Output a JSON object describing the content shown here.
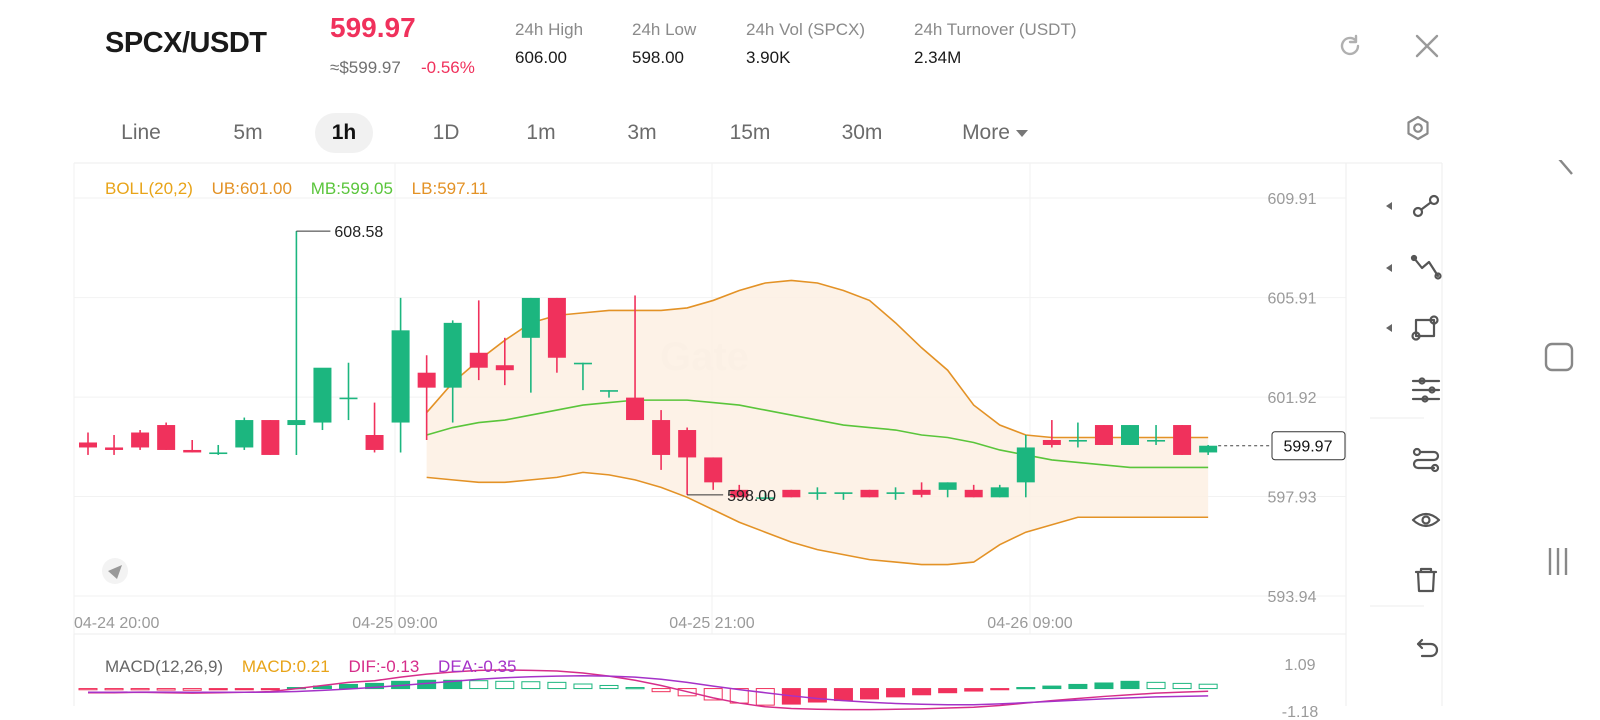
{
  "header": {
    "pair": "SPCX/USDT",
    "last_price": "599.97",
    "usd_price": "≈$599.97",
    "change": "-0.56%",
    "stats": [
      {
        "label": "24h   High",
        "value": "606.00"
      },
      {
        "label": "24h   Low",
        "value": "598.00"
      },
      {
        "label": "24h   Vol (SPCX)",
        "value": "3.90K"
      },
      {
        "label": "24h   Turnover (USDT)",
        "value": "2.34M"
      }
    ]
  },
  "tabs": [
    {
      "label": "Line"
    },
    {
      "label": "5m"
    },
    {
      "label": "1h",
      "active": true
    },
    {
      "label": "1D"
    },
    {
      "label": "1m"
    },
    {
      "label": "3m"
    },
    {
      "label": "15m"
    },
    {
      "label": "30m"
    },
    {
      "label": "More"
    }
  ],
  "colors": {
    "up": "#1cb67f",
    "down": "#f0315c",
    "boll_title": "#e8a419",
    "boll_ub": "#e39226",
    "boll_mb": "#5ac53b",
    "boll_lb": "#e39226",
    "macd": "#e8a419",
    "dif": "#d62d8a",
    "dea": "#a532c8"
  },
  "toolbar_icons": [
    "line-tool-icon",
    "trend-tool-icon",
    "shape-tool-icon",
    "indicator-settings-icon",
    "template-icon",
    "visibility-icon",
    "delete-icon",
    "undo-icon"
  ],
  "chart_data": [
    {
      "type": "candlestick",
      "indicator": {
        "title": "BOLL(20,2)",
        "ub_label": "UB:601.00",
        "mb_label": "MB:599.05",
        "lb_label": "LB:597.11"
      },
      "x_ticks": [
        "04-24 20:00",
        "04-25 09:00",
        "04-25 21:00",
        "04-26 09:00"
      ],
      "y_ticks": [
        "609.91",
        "605.91",
        "601.92",
        "597.93",
        "593.94"
      ],
      "ylim": [
        593.94,
        609.91
      ],
      "max_marker": "608.58",
      "min_marker": "598.00",
      "last_price_tag": "599.97",
      "candles": [
        {
          "o": 600.1,
          "h": 600.5,
          "l": 599.6,
          "c": 599.9
        },
        {
          "o": 599.9,
          "h": 600.4,
          "l": 599.6,
          "c": 599.8
        },
        {
          "o": 600.5,
          "h": 600.6,
          "l": 599.8,
          "c": 599.9
        },
        {
          "o": 600.8,
          "h": 600.9,
          "l": 599.8,
          "c": 599.8
        },
        {
          "o": 599.8,
          "h": 600.2,
          "l": 599.7,
          "c": 599.7
        },
        {
          "o": 599.7,
          "h": 600.0,
          "l": 599.6,
          "c": 599.7
        },
        {
          "o": 599.9,
          "h": 601.1,
          "l": 599.8,
          "c": 601.0
        },
        {
          "o": 601.0,
          "h": 601.0,
          "l": 599.6,
          "c": 599.6
        },
        {
          "o": 600.8,
          "h": 608.58,
          "l": 599.6,
          "c": 601.0
        },
        {
          "o": 600.9,
          "h": 602.3,
          "l": 600.6,
          "c": 603.1
        },
        {
          "o": 601.9,
          "h": 603.3,
          "l": 601.0,
          "c": 601.9
        },
        {
          "o": 600.4,
          "h": 601.7,
          "l": 599.7,
          "c": 599.8
        },
        {
          "o": 600.9,
          "h": 605.9,
          "l": 599.7,
          "c": 604.6
        },
        {
          "o": 602.9,
          "h": 603.6,
          "l": 600.2,
          "c": 602.3
        },
        {
          "o": 602.3,
          "h": 605.0,
          "l": 600.9,
          "c": 604.9
        },
        {
          "o": 603.7,
          "h": 605.8,
          "l": 602.6,
          "c": 603.1
        },
        {
          "o": 603.2,
          "h": 604.3,
          "l": 602.4,
          "c": 603.0
        },
        {
          "o": 604.3,
          "h": 605.9,
          "l": 602.1,
          "c": 605.9
        },
        {
          "o": 605.9,
          "h": 605.9,
          "l": 602.9,
          "c": 603.5
        },
        {
          "o": 603.3,
          "h": 603.3,
          "l": 602.2,
          "c": 603.3
        },
        {
          "o": 602.2,
          "h": 602.2,
          "l": 601.9,
          "c": 602.2
        },
        {
          "o": 601.9,
          "h": 606.0,
          "l": 601.0,
          "c": 601.0
        },
        {
          "o": 601.0,
          "h": 601.4,
          "l": 599.0,
          "c": 599.6
        },
        {
          "o": 600.6,
          "h": 600.7,
          "l": 598.0,
          "c": 599.5
        },
        {
          "o": 599.5,
          "h": 599.5,
          "l": 598.2,
          "c": 598.5
        },
        {
          "o": 598.2,
          "h": 598.4,
          "l": 597.9,
          "c": 597.9
        },
        {
          "o": 597.9,
          "h": 598.1,
          "l": 597.8,
          "c": 597.9
        },
        {
          "o": 598.2,
          "h": 598.2,
          "l": 597.9,
          "c": 597.9
        },
        {
          "o": 598.1,
          "h": 598.3,
          "l": 597.8,
          "c": 598.1
        },
        {
          "o": 598.1,
          "h": 598.1,
          "l": 597.8,
          "c": 598.1
        },
        {
          "o": 598.2,
          "h": 598.2,
          "l": 597.9,
          "c": 597.9
        },
        {
          "o": 598.1,
          "h": 598.3,
          "l": 597.8,
          "c": 598.1
        },
        {
          "o": 598.2,
          "h": 598.5,
          "l": 597.9,
          "c": 598.0
        },
        {
          "o": 598.2,
          "h": 598.5,
          "l": 597.9,
          "c": 598.5
        },
        {
          "o": 598.2,
          "h": 598.4,
          "l": 597.9,
          "c": 597.9
        },
        {
          "o": 597.9,
          "h": 598.4,
          "l": 597.9,
          "c": 598.3
        },
        {
          "o": 598.5,
          "h": 600.4,
          "l": 597.9,
          "c": 599.9
        },
        {
          "o": 600.2,
          "h": 601.0,
          "l": 599.9,
          "c": 600.0
        },
        {
          "o": 600.2,
          "h": 600.9,
          "l": 599.9,
          "c": 600.2
        },
        {
          "o": 600.8,
          "h": 600.8,
          "l": 600.0,
          "c": 600.0
        },
        {
          "o": 600.0,
          "h": 600.8,
          "l": 600.0,
          "c": 600.8
        },
        {
          "o": 600.2,
          "h": 600.8,
          "l": 600.0,
          "c": 600.2
        },
        {
          "o": 600.8,
          "h": 600.8,
          "l": 599.6,
          "c": 599.6
        },
        {
          "o": 599.7,
          "h": 600.0,
          "l": 599.6,
          "c": 599.97
        }
      ],
      "boll_start_index": 13,
      "boll_ub": [
        601.3,
        602.5,
        603.4,
        604.2,
        604.9,
        605.2,
        605.3,
        605.4,
        605.4,
        605.4,
        605.5,
        605.8,
        606.2,
        606.5,
        606.6,
        606.5,
        606.2,
        605.8,
        604.9,
        603.9,
        603.0,
        601.6,
        600.8,
        600.4,
        600.3,
        600.3,
        600.3,
        600.3,
        600.3,
        600.3,
        600.3
      ],
      "boll_mb": [
        600.4,
        600.7,
        600.9,
        601.0,
        601.2,
        601.4,
        601.6,
        601.7,
        601.8,
        601.8,
        601.8,
        601.7,
        601.6,
        601.4,
        601.2,
        601.0,
        600.8,
        600.7,
        600.6,
        600.4,
        600.3,
        600.1,
        599.8,
        599.6,
        599.4,
        599.3,
        599.2,
        599.1,
        599.1,
        599.1,
        599.1
      ],
      "boll_lb": [
        598.7,
        598.6,
        598.5,
        598.5,
        598.6,
        598.7,
        598.9,
        598.8,
        598.6,
        598.3,
        597.9,
        597.4,
        596.9,
        596.5,
        596.1,
        595.8,
        595.6,
        595.4,
        595.3,
        595.2,
        595.2,
        595.3,
        596.0,
        596.5,
        596.8,
        597.1,
        597.1,
        597.1,
        597.1,
        597.1,
        597.1
      ]
    },
    {
      "type": "macd",
      "title": "MACD(12,26,9)",
      "macd_label": "MACD:0.21",
      "dif_label": "DIF:-0.13",
      "dea_label": "DEA:-0.35",
      "y_ticks": [
        "1.09",
        "-1.18"
      ],
      "ylim": [
        -1.18,
        1.09
      ],
      "hist": [
        -0.05,
        -0.06,
        -0.06,
        -0.07,
        -0.08,
        -0.06,
        -0.04,
        -0.03,
        0.05,
        0.12,
        0.2,
        0.25,
        0.35,
        0.4,
        0.4,
        0.38,
        0.35,
        0.33,
        0.3,
        0.22,
        0.15,
        0.05,
        -0.15,
        -0.35,
        -0.55,
        -0.7,
        -0.8,
        -0.75,
        -0.65,
        -0.58,
        -0.5,
        -0.4,
        -0.3,
        -0.2,
        -0.12,
        -0.05,
        0.05,
        0.12,
        0.2,
        0.27,
        0.35,
        0.3,
        0.25,
        0.21
      ],
      "dif": [
        -0.2,
        -0.2,
        -0.18,
        -0.2,
        -0.22,
        -0.2,
        -0.18,
        -0.15,
        0.0,
        0.15,
        0.3,
        0.38,
        0.55,
        0.7,
        0.8,
        0.88,
        0.9,
        0.88,
        0.85,
        0.75,
        0.6,
        0.4,
        0.15,
        -0.15,
        -0.45,
        -0.7,
        -0.88,
        -0.96,
        -1.0,
        -1.02,
        -1.02,
        -1.0,
        -0.98,
        -0.94,
        -0.9,
        -0.82,
        -0.7,
        -0.58,
        -0.48,
        -0.38,
        -0.3,
        -0.22,
        -0.17,
        -0.13
      ],
      "dea": [
        -0.18,
        -0.18,
        -0.17,
        -0.17,
        -0.18,
        -0.18,
        -0.18,
        -0.17,
        -0.14,
        -0.09,
        -0.02,
        0.06,
        0.15,
        0.25,
        0.35,
        0.45,
        0.52,
        0.57,
        0.6,
        0.62,
        0.6,
        0.55,
        0.45,
        0.3,
        0.12,
        -0.05,
        -0.2,
        -0.35,
        -0.48,
        -0.58,
        -0.66,
        -0.72,
        -0.76,
        -0.78,
        -0.78,
        -0.74,
        -0.68,
        -0.62,
        -0.56,
        -0.5,
        -0.45,
        -0.4,
        -0.38,
        -0.35
      ]
    }
  ]
}
